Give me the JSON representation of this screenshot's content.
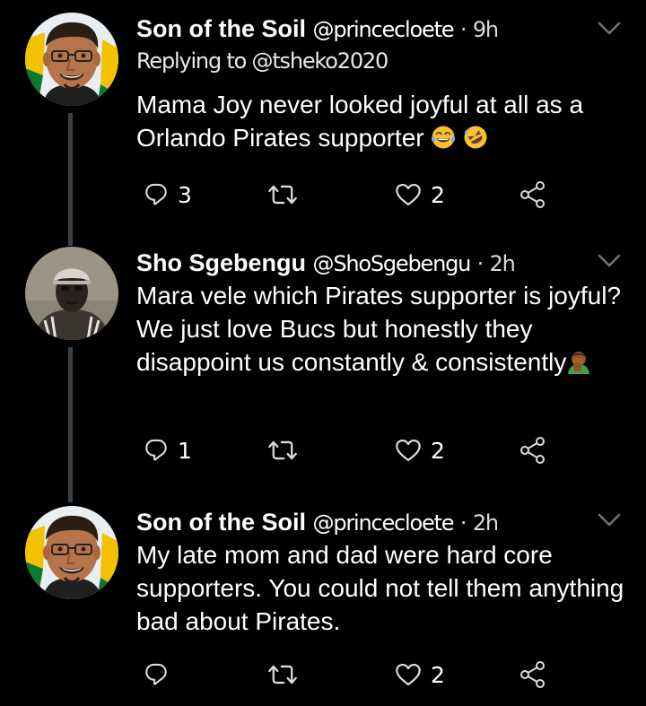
{
  "tweets": [
    {
      "name": "Son of the Soil",
      "handle": "@princecloete",
      "separator": "·",
      "time": "9h",
      "reply_to": "Replying to @tsheko2020",
      "text": "Mama Joy never looked joyful at all as a Orlando Pirates supporter",
      "emojis": [
        "tears-of-joy",
        "rolling-on-floor-laughing"
      ],
      "reply_count": "3",
      "like_count": "2",
      "avatar": "man-with-glasses-photo"
    },
    {
      "name": "Sho Sgebengu",
      "handle": "@ShoSgebengu",
      "separator": "·",
      "time": "2h",
      "text": "Mara vele which Pirates supporter is joyful? We just love Bucs but honestly they disappoint us constantly & consistently",
      "emojis": [
        "man-facepalming"
      ],
      "reply_count": "1",
      "like_count": "2",
      "avatar": "man-in-cap-photo"
    },
    {
      "name": "Son of the Soil",
      "handle": "@princecloete",
      "separator": "·",
      "time": "2h",
      "text": "My late mom and dad were hard core supporters. You could not tell them anything bad about Pirates.",
      "emojis": [],
      "reply_count": "",
      "like_count": "2",
      "avatar": "man-with-glasses-photo"
    }
  ],
  "icons": {
    "reply": "reply-icon",
    "retweet": "retweet-icon",
    "like": "like-icon",
    "share": "share-icon",
    "more": "chevron-down-icon"
  },
  "colors": {
    "background": "#000000",
    "text": "#ffffff",
    "icon": "#d9dcdf",
    "thread_line": "#3d4145"
  }
}
